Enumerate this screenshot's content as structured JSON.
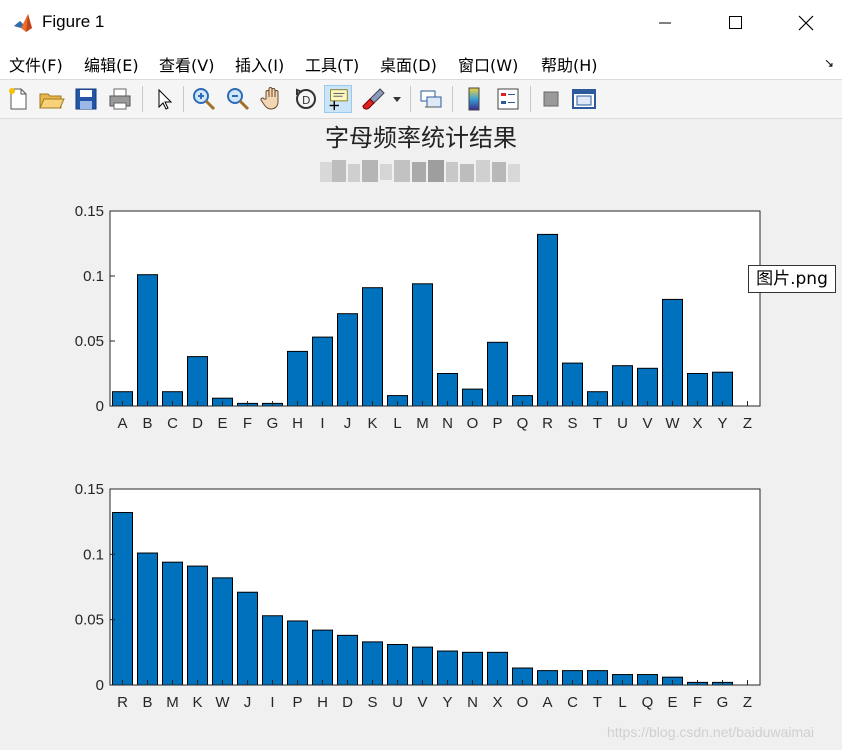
{
  "window": {
    "title": "Figure 1"
  },
  "menu": [
    "文件(F)",
    "编辑(E)",
    "查看(V)",
    "插入(I)",
    "工具(T)",
    "桌面(D)",
    "窗口(W)",
    "帮助(H)"
  ],
  "toolbar_icons": [
    "new-figure-icon",
    "open-file-icon",
    "save-icon",
    "print-icon",
    "select-arrow-icon",
    "zoom-in-icon",
    "zoom-out-icon",
    "pan-hand-icon",
    "rotate-3d-icon",
    "data-cursor-icon",
    "brush-icon",
    "link-plot-icon",
    "colorbar-icon",
    "legend-icon",
    "hide-plot-tools-icon",
    "show-plot-tools-icon"
  ],
  "figure": {
    "title": "字母频率统计结果",
    "legend_label": "图片.png"
  },
  "watermark": "https://blog.csdn.net/baiduwaimai",
  "colors": {
    "bar": "#0072BD",
    "axes_bg": "#ffffff",
    "figure_bg": "#f0f0f0"
  },
  "chart_data": [
    {
      "type": "bar",
      "categories": [
        "A",
        "B",
        "C",
        "D",
        "E",
        "F",
        "G",
        "H",
        "I",
        "J",
        "K",
        "L",
        "M",
        "N",
        "O",
        "P",
        "Q",
        "R",
        "S",
        "T",
        "U",
        "V",
        "W",
        "X",
        "Y",
        "Z"
      ],
      "values": [
        0.011,
        0.101,
        0.011,
        0.038,
        0.006,
        0.002,
        0.002,
        0.042,
        0.053,
        0.071,
        0.091,
        0.008,
        0.094,
        0.025,
        0.013,
        0.049,
        0.008,
        0.132,
        0.033,
        0.011,
        0.031,
        0.029,
        0.082,
        0.025,
        0.026,
        0.0
      ],
      "ylim": [
        0,
        0.15
      ],
      "yticks": [
        0,
        0.05,
        0.1,
        0.15
      ],
      "ytick_labels": [
        "0",
        "0.05",
        "0.1",
        "0.15"
      ],
      "grid": false
    },
    {
      "type": "bar",
      "categories": [
        "R",
        "B",
        "M",
        "K",
        "W",
        "J",
        "I",
        "P",
        "H",
        "D",
        "S",
        "U",
        "V",
        "Y",
        "N",
        "X",
        "O",
        "A",
        "C",
        "T",
        "L",
        "Q",
        "E",
        "F",
        "G",
        "Z"
      ],
      "values": [
        0.132,
        0.101,
        0.094,
        0.091,
        0.082,
        0.071,
        0.053,
        0.049,
        0.042,
        0.038,
        0.033,
        0.031,
        0.029,
        0.026,
        0.025,
        0.025,
        0.013,
        0.011,
        0.011,
        0.011,
        0.008,
        0.008,
        0.006,
        0.002,
        0.002,
        0.0
      ],
      "ylim": [
        0,
        0.15
      ],
      "yticks": [
        0,
        0.05,
        0.1,
        0.15
      ],
      "ytick_labels": [
        "0",
        "0.05",
        "0.1",
        "0.15"
      ],
      "grid": false
    }
  ]
}
